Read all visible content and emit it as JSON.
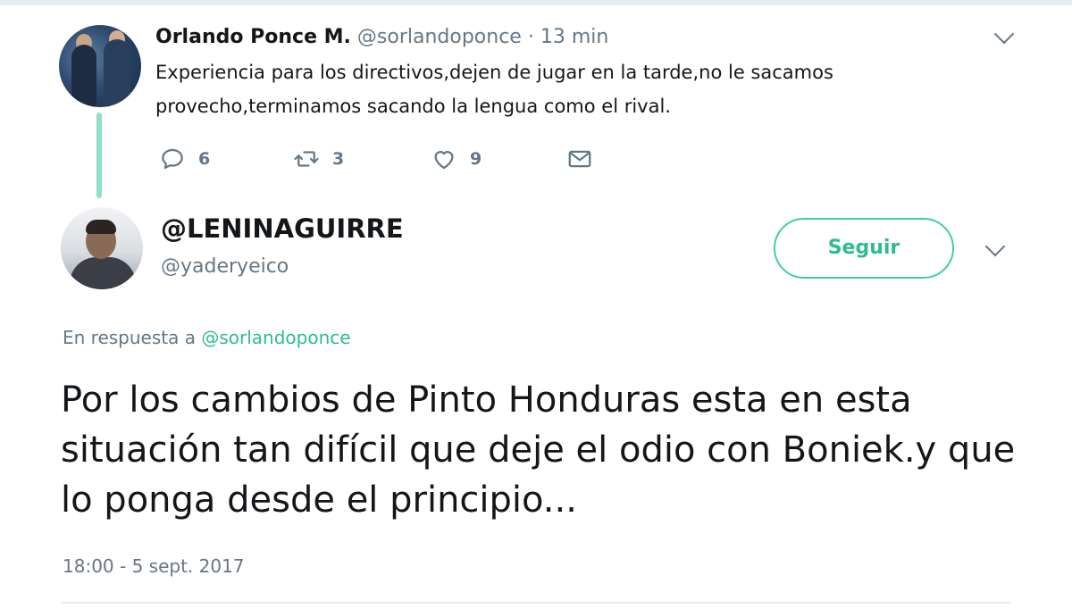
{
  "parent_tweet": {
    "author_name": "Orlando Ponce M.",
    "handle": "@sorlandoponce",
    "separator": "·",
    "time": "13 min",
    "text": "Experiencia para los directivos,dejen de jugar en la tarde,no le sacamos provecho,terminamos sacando la lengua como el rival.",
    "actions": {
      "reply_count": "6",
      "retweet_count": "3",
      "like_count": "9"
    }
  },
  "main_tweet": {
    "author_name": "@LENINAGUIRRE",
    "handle": "@yaderyeico",
    "follow_label": "Seguir",
    "reply_to_prefix": "En respuesta a",
    "reply_to_handle": "@sorlandoponce",
    "text": "Por los cambios de Pinto Honduras esta en esta situación tan difícil que deje el odio con Boniek.y que lo ponga desde el principio...",
    "timestamp": "18:00 - 5 sept. 2017"
  },
  "colors": {
    "accent": "#2dbd8b",
    "thread_line": "#8fe0c4",
    "secondary_text": "#657786",
    "primary_text": "#14171a"
  },
  "icons": [
    "reply-icon",
    "retweet-icon",
    "like-icon",
    "direct-message-icon",
    "chevron-down-icon"
  ]
}
